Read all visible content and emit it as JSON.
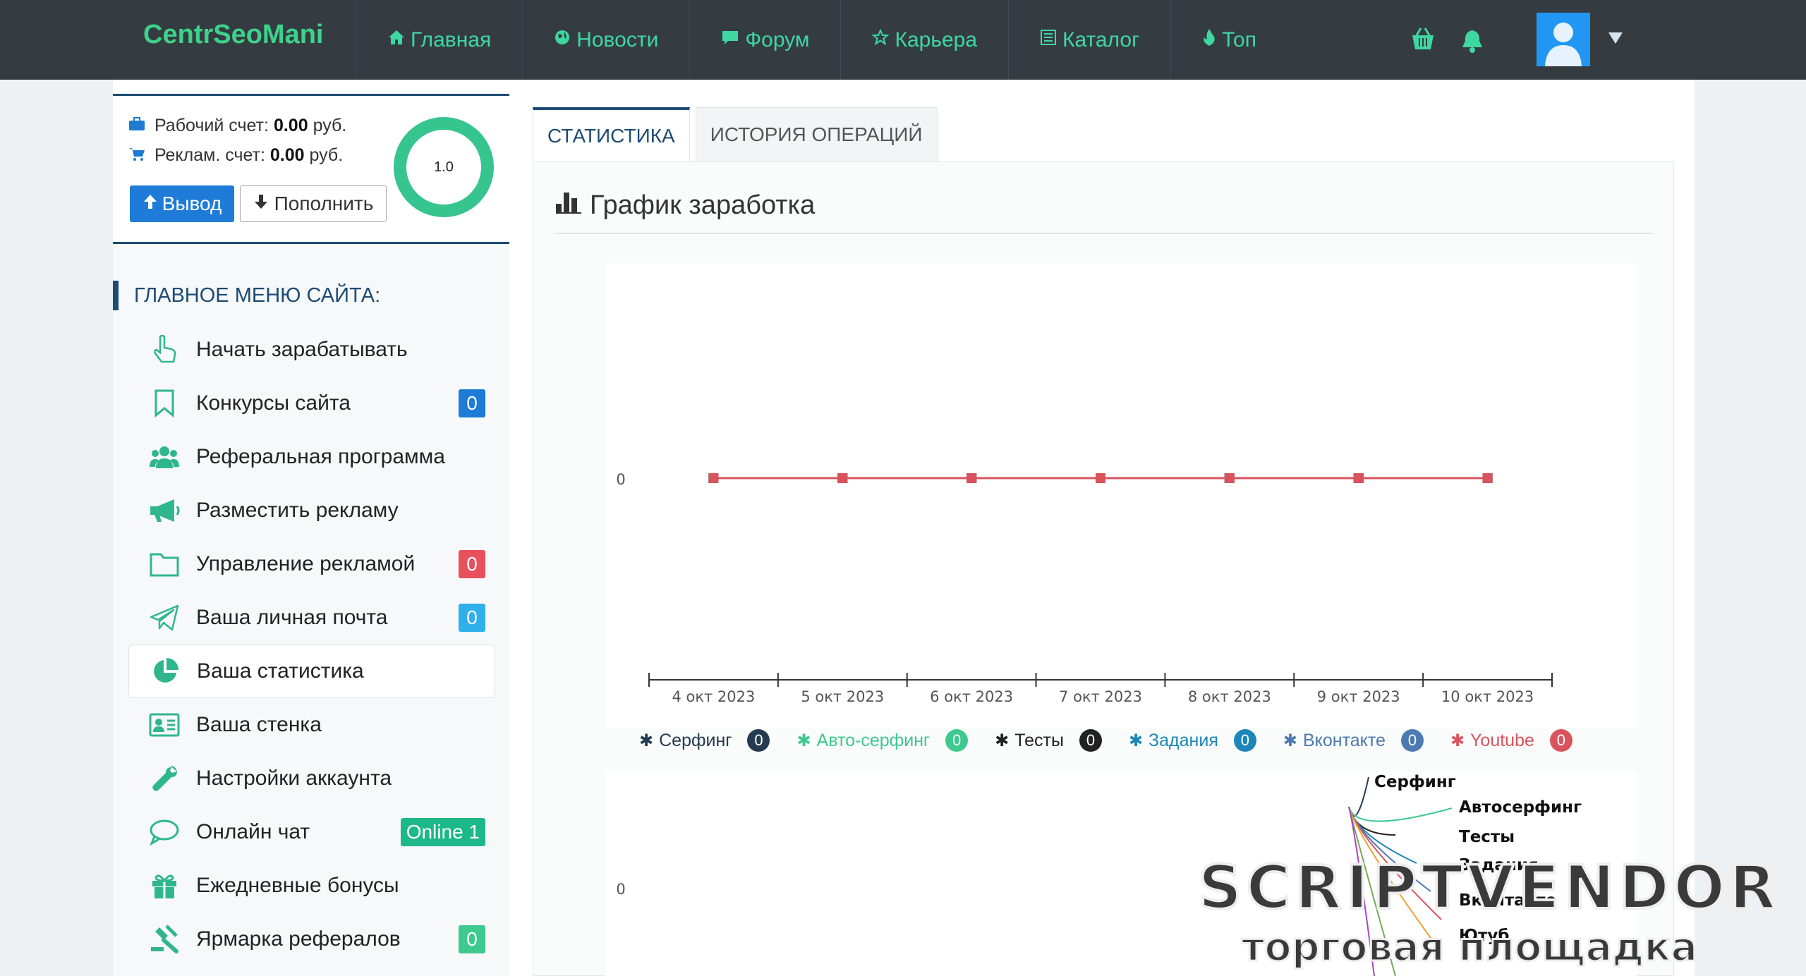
{
  "brand": "CentrSeoMani",
  "nav": [
    {
      "label": "Главная",
      "icon": "home-icon"
    },
    {
      "label": "Новости",
      "icon": "globe-icon"
    },
    {
      "label": "Форум",
      "icon": "comment-icon"
    },
    {
      "label": "Карьера",
      "icon": "star-icon"
    },
    {
      "label": "Каталог",
      "icon": "list-icon"
    },
    {
      "label": "Топ",
      "icon": "fire-icon"
    }
  ],
  "wallet": {
    "work_label": "Рабочий счет:",
    "work_value": "0.00",
    "work_currency": "руб.",
    "ads_label": "Реклам. счет:",
    "ads_value": "0.00",
    "ads_currency": "руб.",
    "withdraw_label": "Вывод",
    "topup_label": "Пополнить",
    "ring_value": "1.0"
  },
  "menu": {
    "heading": "ГЛАВНОЕ МЕНЮ САЙТА:",
    "items": [
      {
        "label": "Начать зарабатывать",
        "icon": "hand-pointer-icon",
        "badge": null
      },
      {
        "label": "Конкурсы сайта",
        "icon": "bookmark-icon",
        "badge": "0",
        "badge_color": "#1e7bd8"
      },
      {
        "label": "Реферальная программа",
        "icon": "users-icon",
        "badge": null
      },
      {
        "label": "Разместить рекламу",
        "icon": "megaphone-icon",
        "badge": null
      },
      {
        "label": "Управление рекламой",
        "icon": "folder-icon",
        "badge": "0",
        "badge_color": "#e8505b"
      },
      {
        "label": "Ваша личная почта",
        "icon": "paper-plane-icon",
        "badge": "0",
        "badge_color": "#2fb0ea"
      },
      {
        "label": "Ваша статистика",
        "icon": "pie-chart-icon",
        "badge": null
      },
      {
        "label": "Ваша стенка",
        "icon": "id-card-icon",
        "badge": null
      },
      {
        "label": "Настройки аккаунта",
        "icon": "wrench-icon",
        "badge": null
      },
      {
        "label": "Онлайн чат",
        "icon": "chat-bubble-icon",
        "badge": "Online 1",
        "badge_color": "#1cb88a"
      },
      {
        "label": "Ежедневные бонусы",
        "icon": "gift-icon",
        "badge": null
      },
      {
        "label": "Ярмарка рефералов",
        "icon": "gavel-icon",
        "badge": "0",
        "badge_color": "#3ec98f"
      }
    ]
  },
  "tabs": [
    "СТАТИСТИКА",
    "ИСТОРИЯ ОПЕРАЦИЙ"
  ],
  "panel_title": "График заработка",
  "chart_data": {
    "type": "line",
    "categories": [
      "4 окт 2023",
      "5 окт 2023",
      "6 окт 2023",
      "7 окт 2023",
      "8 окт 2023",
      "9 окт 2023",
      "10 окт 2023"
    ],
    "y_tick": "0",
    "series": [
      {
        "name": "Серфинг",
        "values": [
          0,
          0,
          0,
          0,
          0,
          0,
          0
        ],
        "color": "#253b52",
        "total": "0"
      },
      {
        "name": "Авто-серфинг",
        "values": [
          0,
          0,
          0,
          0,
          0,
          0,
          0
        ],
        "color": "#3ec98f",
        "total": "0"
      },
      {
        "name": "Тесты",
        "values": [
          0,
          0,
          0,
          0,
          0,
          0,
          0
        ],
        "color": "#222222",
        "total": "0"
      },
      {
        "name": "Задания",
        "values": [
          0,
          0,
          0,
          0,
          0,
          0,
          0
        ],
        "color": "#1c86b8",
        "total": "0"
      },
      {
        "name": "Вконтакте",
        "values": [
          0,
          0,
          0,
          0,
          0,
          0,
          0
        ],
        "color": "#4d7ab0",
        "total": "0"
      },
      {
        "name": "Youtube",
        "values": [
          0,
          0,
          0,
          0,
          0,
          0,
          0
        ],
        "color": "#d9535d",
        "total": "0"
      }
    ]
  },
  "chart2": {
    "y_tick": "0",
    "labels": [
      "Серфинг",
      "Автосерфинг",
      "Тесты",
      "Задания",
      "Вконтакте",
      "Ютуб"
    ]
  },
  "watermark": {
    "title": "SCRIPTVENDOR",
    "subtitle": "торговая площадка"
  }
}
